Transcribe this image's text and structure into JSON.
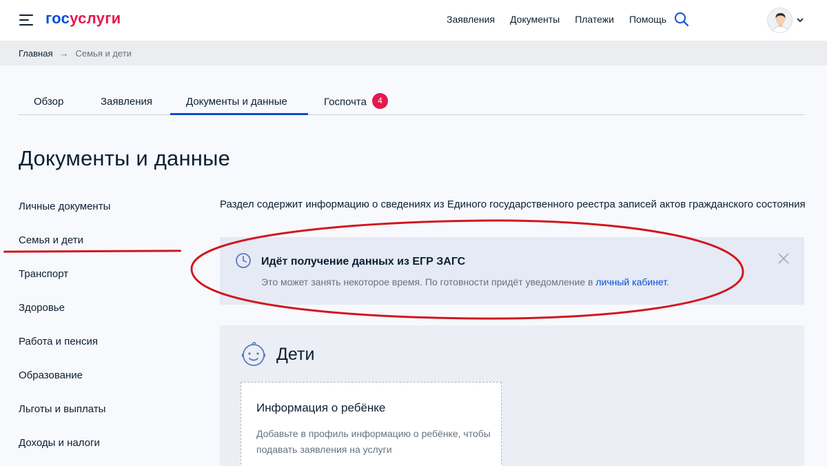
{
  "header": {
    "logo_part1": "гос",
    "logo_part2": "услуги",
    "nav": [
      "Заявления",
      "Документы",
      "Платежи",
      "Помощь"
    ]
  },
  "breadcrumb": {
    "home": "Главная",
    "arrow": "→",
    "current": "Семья и дети"
  },
  "tabs": [
    {
      "label": "Обзор"
    },
    {
      "label": "Заявления"
    },
    {
      "label": "Документы и данные",
      "active": true
    },
    {
      "label": "Госпочта",
      "badge": "4"
    }
  ],
  "page_title": "Документы и данные",
  "sidebar": {
    "items": [
      {
        "label": "Личные документы"
      },
      {
        "label": "Семья и дети",
        "active": true
      },
      {
        "label": "Транспорт"
      },
      {
        "label": "Здоровье"
      },
      {
        "label": "Работа и пенсия"
      },
      {
        "label": "Образование"
      },
      {
        "label": "Льготы и выплаты"
      },
      {
        "label": "Доходы и налоги"
      }
    ]
  },
  "main": {
    "intro": "Раздел содержит информацию о сведениях из Единого государственного реестра записей актов гражданского состояния",
    "notice": {
      "title": "Идёт получение данных из ЕГР ЗАГС",
      "text_before": "Это может занять некоторое время. По готовности придёт уведомление в ",
      "link": "личный кабинет",
      "text_after": "."
    },
    "children_card": {
      "title": "Дети",
      "info_title": "Информация о ребёнке",
      "info_text": "Добавьте в профиль информацию о ребёнке, чтобы подавать заявления на услуги"
    }
  },
  "colors": {
    "brand_blue": "#0d4cd3",
    "brand_red": "#e3184f",
    "annotation_red": "#d2161e",
    "notice_bg": "#e5eaf5"
  },
  "icons": [
    "burger-menu-icon",
    "search-icon",
    "avatar-icon",
    "chevron-down-icon",
    "clock-icon",
    "close-icon",
    "baby-face-icon"
  ]
}
